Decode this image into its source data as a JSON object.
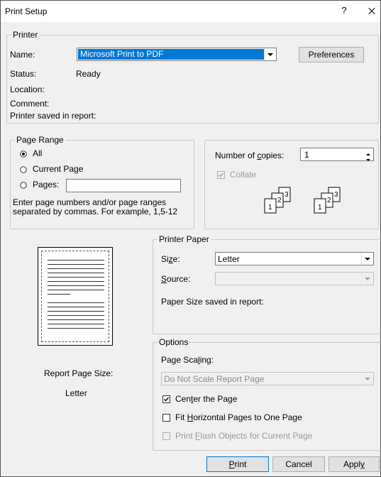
{
  "window": {
    "title": "Print Setup",
    "help_glyph": "?"
  },
  "printer": {
    "legend": "Printer",
    "name_label": "Name:",
    "name_value": "Microsoft Print to PDF",
    "preferences_label": "Preferences",
    "status_label": "Status:",
    "status_value": "Ready",
    "location_label": "Location:",
    "comment_label": "Comment:",
    "saved_label": "Printer saved in report:"
  },
  "page_range": {
    "legend": "Page Range",
    "all_label": "All",
    "current_label": "Current Page",
    "pages_label": "Pages:",
    "pages_value": "",
    "hint_line1": "Enter page numbers and/or page ranges",
    "hint_line2": "separated by commas. For example, 1,5-12",
    "selected": "All"
  },
  "copies": {
    "label": "Number of copies:",
    "value": "1",
    "collate_label": "Collate",
    "collate_checked": true,
    "collate_enabled": false,
    "pages": [
      "1",
      "2",
      "3"
    ]
  },
  "preview": {
    "report_size_label": "Report Page Size:",
    "report_size_value": "Letter"
  },
  "printer_paper": {
    "legend": "Printer Paper",
    "size_label": "Size:",
    "size_value": "Letter",
    "source_label": "Source:",
    "source_value": "",
    "saved_label": "Paper Size saved in report:"
  },
  "options": {
    "legend": "Options",
    "scaling_label": "Page Scaling:",
    "scaling_value": "Do Not Scale Report Page",
    "center_label": "Center the Page",
    "center_checked": true,
    "fit_label": "Fit Horizontal Pages to One Page",
    "fit_checked": false,
    "flash_label": "Print Flash Objects for Current Page",
    "flash_checked": false
  },
  "buttons": {
    "print": "Print",
    "cancel": "Cancel",
    "apply": "Apply"
  }
}
